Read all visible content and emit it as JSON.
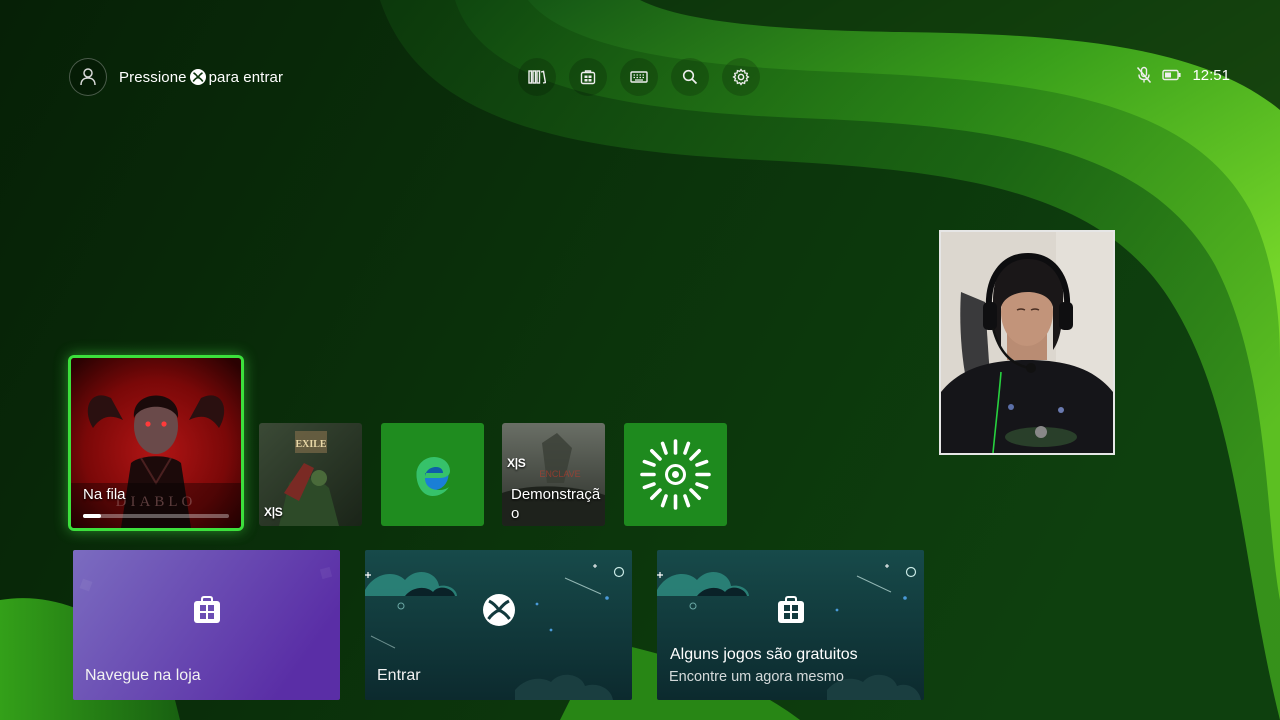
{
  "top_bar": {
    "signin_text_before": "Pressione",
    "signin_text_after": "para entrar",
    "nav_buttons": [
      "library-icon",
      "store-icon",
      "keyboard-icon",
      "search-icon",
      "settings-icon"
    ],
    "mic": "mic-muted-icon",
    "battery": "battery-icon",
    "time": "12:51"
  },
  "tiles": {
    "featured": {
      "label": "Na fila",
      "download_progress": 0.12
    },
    "tile2": {
      "badge": "X|S"
    },
    "tile3": {
      "icon": "edge-icon"
    },
    "tile4": {
      "badge": "X|S",
      "label": "Demonstração"
    },
    "tile5": {
      "icon": "sunburst-icon"
    }
  },
  "cards": {
    "store": {
      "label": "Navegue na loja",
      "icon": "store-bag-icon"
    },
    "signin": {
      "label": "Entrar",
      "icon": "xbox-logo-icon"
    },
    "free_games": {
      "title": "Alguns jogos são gratuitos",
      "subtitle": "Encontre um agora mesmo",
      "icon": "store-bag-icon"
    }
  },
  "colors": {
    "accent": "#3ce03c",
    "edge_tile": "#1f8c1f",
    "sunburst_tile": "#1e8a1e",
    "store_card_from": "#7b6cc0",
    "store_card_to": "#5a2ea6",
    "teal_card": "#12393d"
  }
}
